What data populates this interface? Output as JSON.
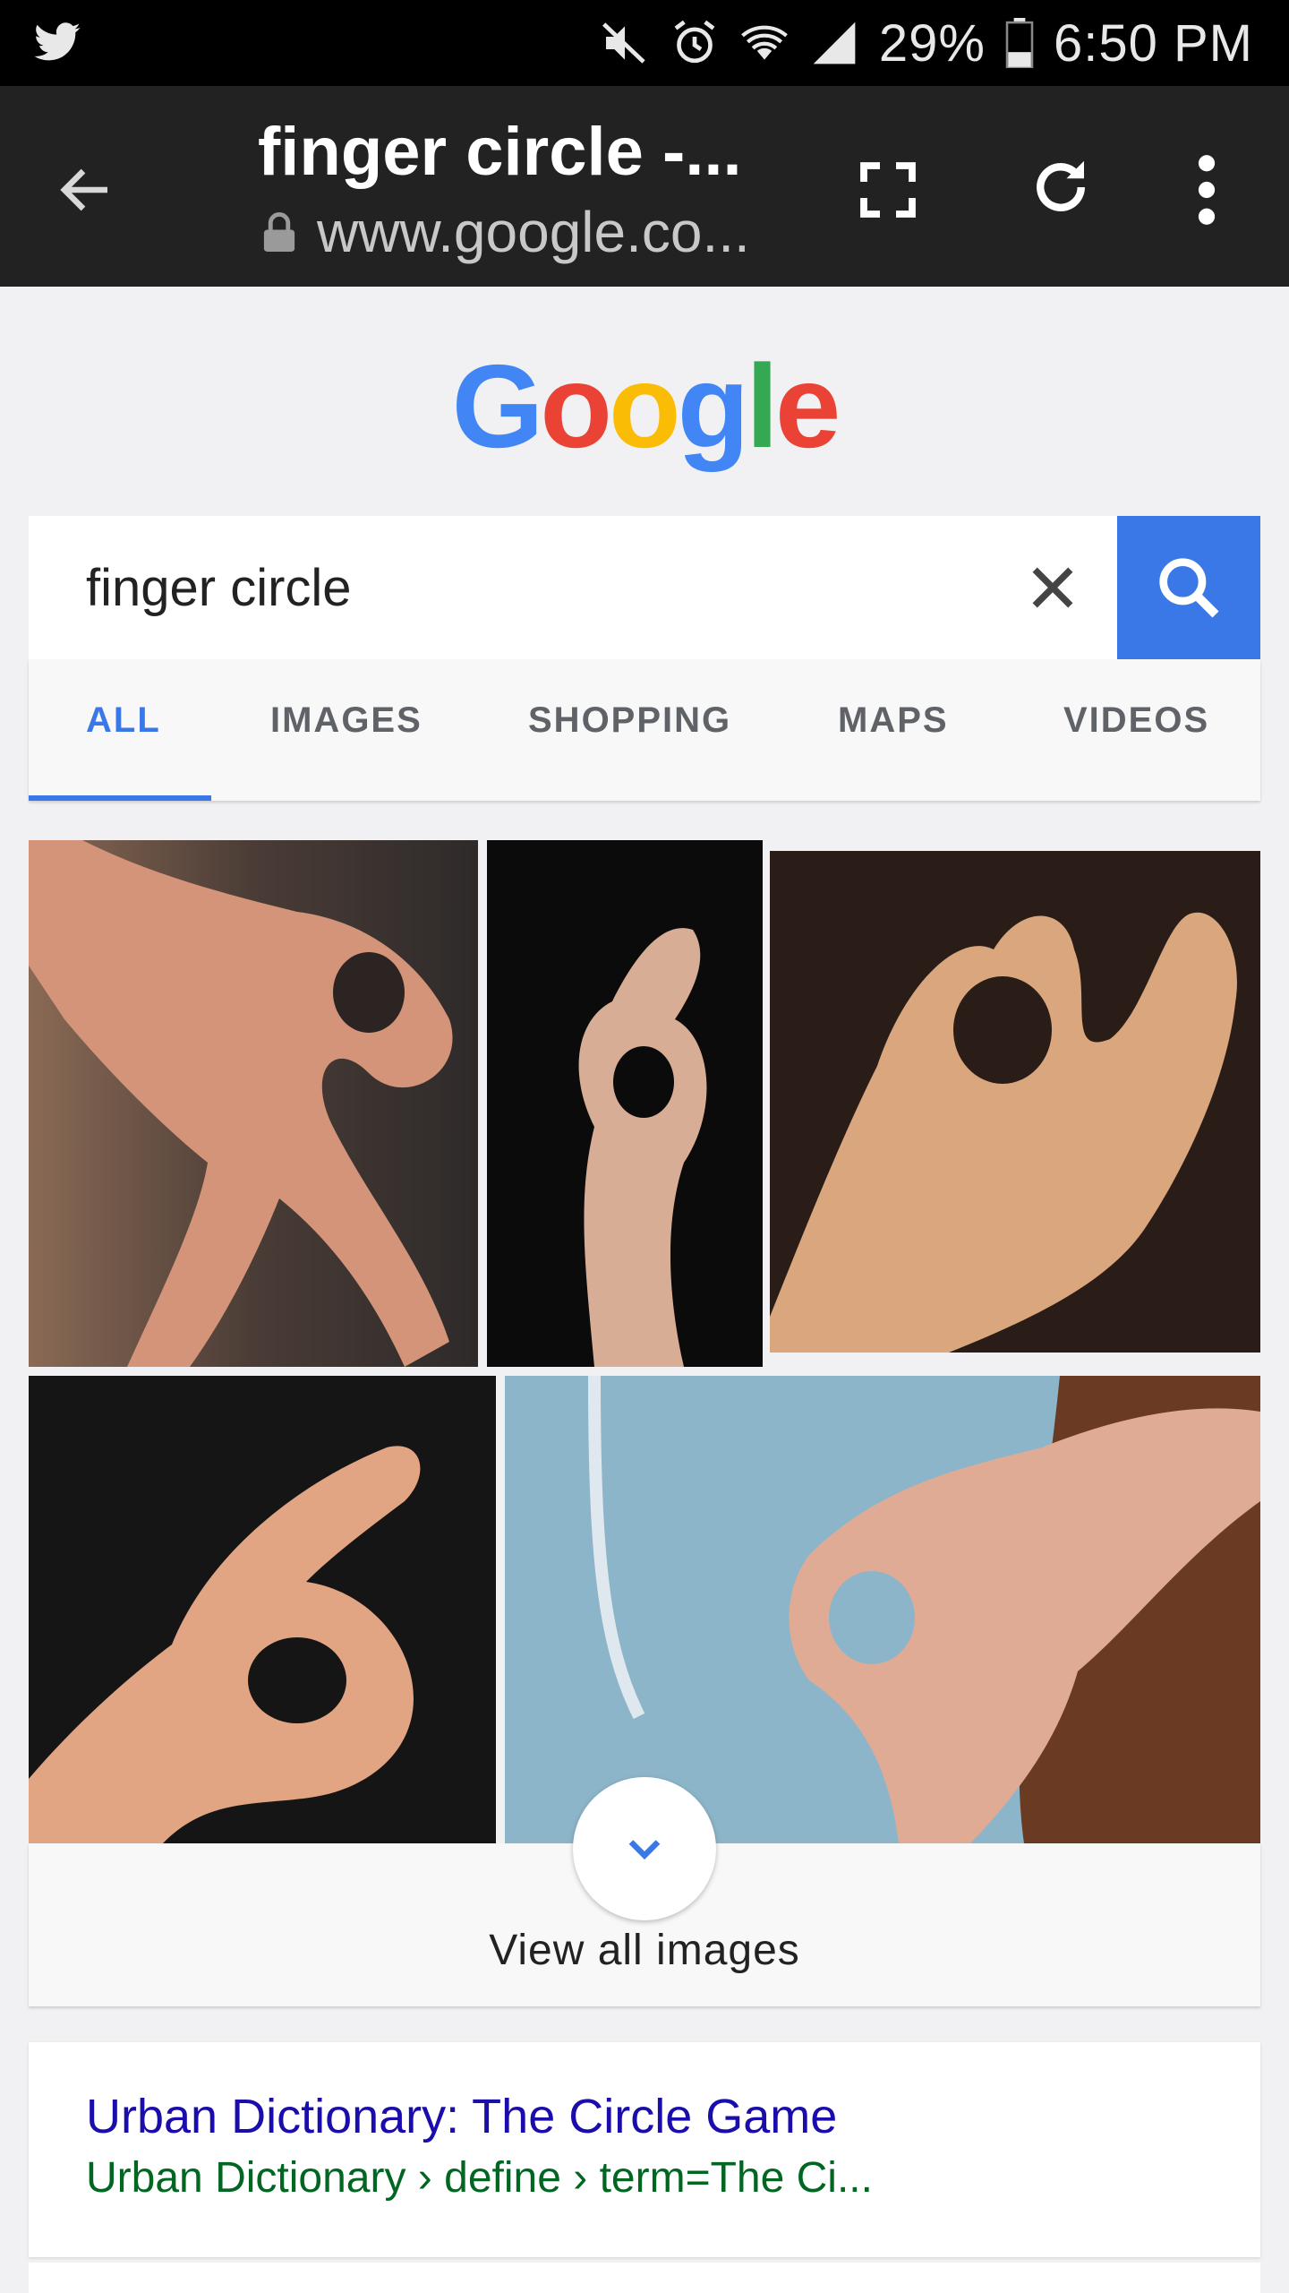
{
  "status_bar": {
    "battery": "29%",
    "time": "6:50 PM",
    "icons": [
      "twitter-icon",
      "mute-icon",
      "alarm-icon",
      "wifi-icon",
      "signal-icon",
      "battery-icon"
    ]
  },
  "toolbar": {
    "title": "finger circle -...",
    "url": "www.google.co...",
    "icons": [
      "back-arrow-icon",
      "lock-icon",
      "fullscreen-icon",
      "reload-icon",
      "more-vert-icon"
    ]
  },
  "logo": {
    "text": [
      "G",
      "o",
      "o",
      "g",
      "l",
      "e"
    ],
    "colors": [
      "#4285f4",
      "#ea4335",
      "#fbbc05",
      "#4285f4",
      "#34a853",
      "#ea4335"
    ]
  },
  "search": {
    "value": "finger circle",
    "icons": [
      "clear-icon",
      "search-icon"
    ]
  },
  "tabs": [
    {
      "label": "ALL",
      "active": true
    },
    {
      "label": "IMAGES",
      "active": false
    },
    {
      "label": "SHOPPING",
      "active": false
    },
    {
      "label": "MAPS",
      "active": false
    },
    {
      "label": "VIDEOS",
      "active": false
    }
  ],
  "images": {
    "count": 5
  },
  "view_all": {
    "label": "View all images",
    "icon": "chevron-down-icon"
  },
  "result": {
    "title": "Urban Dictionary: The Circle Game",
    "url": "Urban Dictionary › define › term=The Ci..."
  },
  "colors": {
    "accent": "#3b78e7",
    "link": "#1a0dab",
    "url_green": "#006621"
  }
}
